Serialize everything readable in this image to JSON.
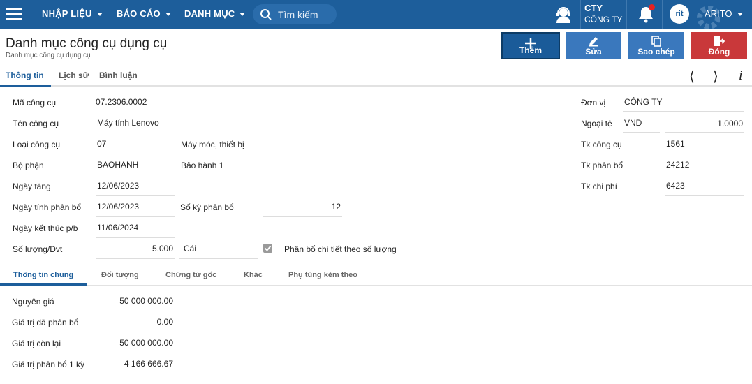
{
  "topbar": {
    "menus": [
      "NHẬP LIỆU",
      "BÁO CÁO",
      "DANH MỤC"
    ],
    "search_placeholder": "Tìm kiếm",
    "company_code": "CTY",
    "company_name": "CÔNG TY",
    "avatar_text": "rit",
    "user": "ARITO"
  },
  "header": {
    "title": "Danh mục công cụ dụng cụ",
    "breadcrumb": "Danh mục công cụ dụng cụ"
  },
  "actions": {
    "add": "Thêm",
    "edit": "Sửa",
    "copy": "Sao chép",
    "close": "Đóng"
  },
  "tabs": [
    "Thông tin",
    "Lịch sử",
    "Bình luận"
  ],
  "form": {
    "ma_cong_cu": {
      "label": "Mã công cụ",
      "value": "07.2306.0002"
    },
    "ten_cong_cu": {
      "label": "Tên công cụ",
      "value": "Máy tính Lenovo"
    },
    "loai_cong_cu": {
      "label": "Loại công cụ",
      "code": "07",
      "name": "Máy móc, thiết bị"
    },
    "bo_phan": {
      "label": "Bộ phận",
      "code": "BAOHANH",
      "name": "Bảo hành 1"
    },
    "ngay_tang": {
      "label": "Ngày tăng",
      "value": "12/06/2023"
    },
    "ngay_tinh_phan_bo": {
      "label": "Ngày tính phân bổ",
      "value": "12/06/2023"
    },
    "so_ky_phan_bo": {
      "label": "Số kỳ phân bổ",
      "value": "12"
    },
    "ngay_ket_thuc": {
      "label": "Ngày kết thúc p/b",
      "value": "11/06/2024"
    },
    "so_luong": {
      "label": "Số lượng/Đvt",
      "value": "5.000",
      "unit": "Cái"
    },
    "phan_bo_chi_tiet": {
      "label": "Phân bổ chi tiết theo số lượng",
      "checked": true
    },
    "don_vi": {
      "label": "Đơn vị",
      "value": "CÔNG TY"
    },
    "ngoai_te": {
      "label": "Ngoại tệ",
      "currency": "VND",
      "rate": "1.0000"
    },
    "tk_cong_cu": {
      "label": "Tk công cụ",
      "value": "1561"
    },
    "tk_phan_bo": {
      "label": "Tk phân bổ",
      "value": "24212"
    },
    "tk_chi_phi": {
      "label": "Tk chi phí",
      "value": "6423"
    }
  },
  "subtabs": [
    "Thông tin chung",
    "Đối tượng",
    "Chứng từ gốc",
    "Khác",
    "Phụ tùng kèm theo"
  ],
  "general": {
    "nguyen_gia": {
      "label": "Nguyên giá",
      "value": "50 000 000.00"
    },
    "gia_tri_da_phan_bo": {
      "label": "Giá trị đã phân bổ",
      "value": "0.00"
    },
    "gia_tri_con_lai": {
      "label": "Giá trị còn lại",
      "value": "50 000 000.00"
    },
    "gia_tri_phan_bo_1_ky": {
      "label": "Giá trị phân bổ 1 kỳ",
      "value": "4 166 666.67"
    }
  },
  "colors": {
    "brand": "#1d5e9b",
    "btn_add": "#1a5b99",
    "btn_edit": "#3a78bd",
    "btn_copy": "#3a78bd",
    "btn_close": "#c9383a"
  }
}
